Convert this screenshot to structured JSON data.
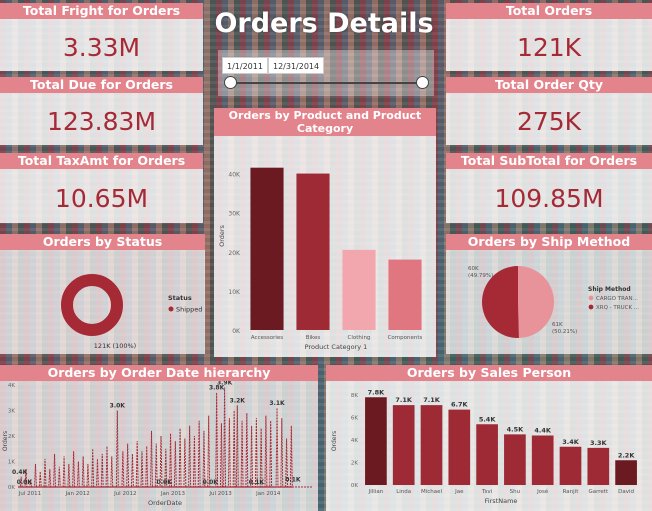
{
  "page_title": "Orders Details",
  "kpis": {
    "freight": {
      "title": "Total Fright for Orders",
      "value": "3.33M"
    },
    "due": {
      "title": "Total Due for Orders",
      "value": "123.83M"
    },
    "tax": {
      "title": "Total TaxAmt for Orders",
      "value": "10.65M"
    },
    "orders": {
      "title": "Total Orders",
      "value": "121K"
    },
    "qty": {
      "title": "Total Order Qty",
      "value": "275K"
    },
    "subtotal": {
      "title": "Total SubTotal for Orders",
      "value": "109.85M"
    }
  },
  "date_slider": {
    "start": "1/1/2011",
    "end": "12/31/2014",
    "start_fraction": 0,
    "end_fraction": 1
  },
  "colors": {
    "dark": "#6b1a22",
    "mid": "#9e2a35",
    "light": "#f1a7ad",
    "pink": "#e0767f",
    "header": "#e3848c",
    "kpi_text": "#a52a36"
  },
  "chart_data": [
    {
      "id": "product",
      "type": "bar",
      "title": "Orders by Product and Product Category",
      "xlabel": "Product Category 1",
      "ylabel": "Orders",
      "categories": [
        "Accessories",
        "Bikes",
        "Clothing",
        "Components"
      ],
      "values": [
        41500,
        40000,
        20500,
        18000
      ],
      "bar_colors": [
        "#6b1a22",
        "#9e2a35",
        "#f1a7ad",
        "#e0767f"
      ],
      "yticks": [
        "0K",
        "10K",
        "20K",
        "30K",
        "40K"
      ],
      "ylim": [
        0,
        45000
      ]
    },
    {
      "id": "status",
      "type": "pie",
      "title": "Orders by Status",
      "legend_title": "Status",
      "slices": [
        {
          "label": "Shipped",
          "value": 121000,
          "data_label": "121K (100%)",
          "color": "#a52a36"
        }
      ]
    },
    {
      "id": "ship",
      "type": "pie",
      "title": "Orders by Ship Method",
      "legend_title": "Ship Method",
      "slices": [
        {
          "label": "CARGO TRAN...",
          "value": 60000,
          "data_label_value": "60K",
          "data_label_pct": "(49.79%)",
          "color": "#e8929a"
        },
        {
          "label": "XRQ - TRUCK ...",
          "value": 61000,
          "data_label_value": "61K",
          "data_label_pct": "(50.21%)",
          "color": "#a52a36"
        }
      ]
    },
    {
      "id": "date",
      "type": "line",
      "title": "Orders by Order Date hierarchy",
      "xlabel": "OrderDate",
      "ylabel": "Orders",
      "yticks": [
        "0K",
        "1K",
        "2K",
        "3K",
        "4K"
      ],
      "ylim": [
        0,
        4000
      ],
      "xticks": [
        "Jul 2011",
        "Jan 2012",
        "Jul 2012",
        "Jan 2013",
        "Jul 2013",
        "Jan 2014"
      ],
      "xrange_months": [
        5,
        42
      ],
      "data_labels": [
        {
          "m": 5.2,
          "v": 400,
          "text": "0.4K"
        },
        {
          "m": 5.8,
          "v": 0,
          "text": "0.0K"
        },
        {
          "m": 17.5,
          "v": 3000,
          "text": "3.0K"
        },
        {
          "m": 23.4,
          "v": 0,
          "text": "0.0K"
        },
        {
          "m": 29.2,
          "v": 0,
          "text": "0.0K"
        },
        {
          "m": 30.0,
          "v": 3700,
          "text": "3.8K"
        },
        {
          "m": 31.0,
          "v": 3900,
          "text": "3.9K"
        },
        {
          "m": 32.6,
          "v": 3200,
          "text": "3.2K"
        },
        {
          "m": 35.0,
          "v": 0,
          "text": "0.1K"
        },
        {
          "m": 37.6,
          "v": 3100,
          "text": "3.1K"
        },
        {
          "m": 39.6,
          "v": 100,
          "text": "0.1K"
        }
      ],
      "spikes": [
        [
          5.4,
          400
        ],
        [
          6.0,
          700
        ],
        [
          6.6,
          300
        ],
        [
          7.2,
          900
        ],
        [
          7.8,
          600
        ],
        [
          8.4,
          1100
        ],
        [
          9.0,
          700
        ],
        [
          9.6,
          1300
        ],
        [
          10.2,
          800
        ],
        [
          10.8,
          1200
        ],
        [
          11.4,
          900
        ],
        [
          12.0,
          1400
        ],
        [
          12.6,
          1000
        ],
        [
          13.2,
          1200
        ],
        [
          13.8,
          900
        ],
        [
          14.4,
          1500
        ],
        [
          15.0,
          1100
        ],
        [
          15.6,
          1300
        ],
        [
          16.2,
          1600
        ],
        [
          16.8,
          1200
        ],
        [
          17.5,
          3000
        ],
        [
          18.2,
          1400
        ],
        [
          18.8,
          1700
        ],
        [
          19.4,
          1300
        ],
        [
          20.0,
          1800
        ],
        [
          20.6,
          1400
        ],
        [
          21.2,
          1600
        ],
        [
          21.8,
          2200
        ],
        [
          22.4,
          1700
        ],
        [
          23.0,
          2000
        ],
        [
          23.6,
          1500
        ],
        [
          24.2,
          2100
        ],
        [
          24.8,
          1800
        ],
        [
          25.4,
          2300
        ],
        [
          26.0,
          1900
        ],
        [
          26.6,
          2400
        ],
        [
          27.2,
          2000
        ],
        [
          27.8,
          2600
        ],
        [
          28.4,
          2200
        ],
        [
          29.0,
          2800
        ],
        [
          30.0,
          3700
        ],
        [
          30.6,
          2500
        ],
        [
          31.0,
          3900
        ],
        [
          31.6,
          2700
        ],
        [
          32.2,
          3000
        ],
        [
          32.6,
          3200
        ],
        [
          33.2,
          2600
        ],
        [
          33.8,
          2900
        ],
        [
          34.4,
          2400
        ],
        [
          35.0,
          2700
        ],
        [
          35.6,
          2300
        ],
        [
          36.2,
          2800
        ],
        [
          36.8,
          2600
        ],
        [
          37.6,
          3100
        ],
        [
          38.2,
          2700
        ],
        [
          38.8,
          1900
        ],
        [
          39.4,
          2400
        ]
      ]
    },
    {
      "id": "salesperson",
      "type": "bar",
      "title": "Orders by Sales Person",
      "xlabel": "FirstName",
      "ylabel": "Orders",
      "categories": [
        "Jillian",
        "Linda",
        "Michael",
        "Jae",
        "Tsvi",
        "Shu",
        "José",
        "Ranjit",
        "Garrett",
        "David"
      ],
      "values": [
        7800,
        7100,
        7100,
        6700,
        5400,
        4500,
        4400,
        3400,
        3300,
        2200
      ],
      "labels": [
        "7.8K",
        "7.1K",
        "7.1K",
        "6.7K",
        "5.4K",
        "4.5K",
        "4.4K",
        "3.4K",
        "3.3K",
        "2.2K"
      ],
      "bar_colors": [
        "#6b1a22",
        "#9e2a35",
        "#9e2a35",
        "#9e2a35",
        "#9e2a35",
        "#9e2a35",
        "#9e2a35",
        "#9e2a35",
        "#9e2a35",
        "#6b1a22"
      ],
      "yticks": [
        "0K",
        "2K",
        "4K",
        "6K",
        "8K"
      ],
      "ylim": [
        0,
        8000
      ]
    }
  ]
}
